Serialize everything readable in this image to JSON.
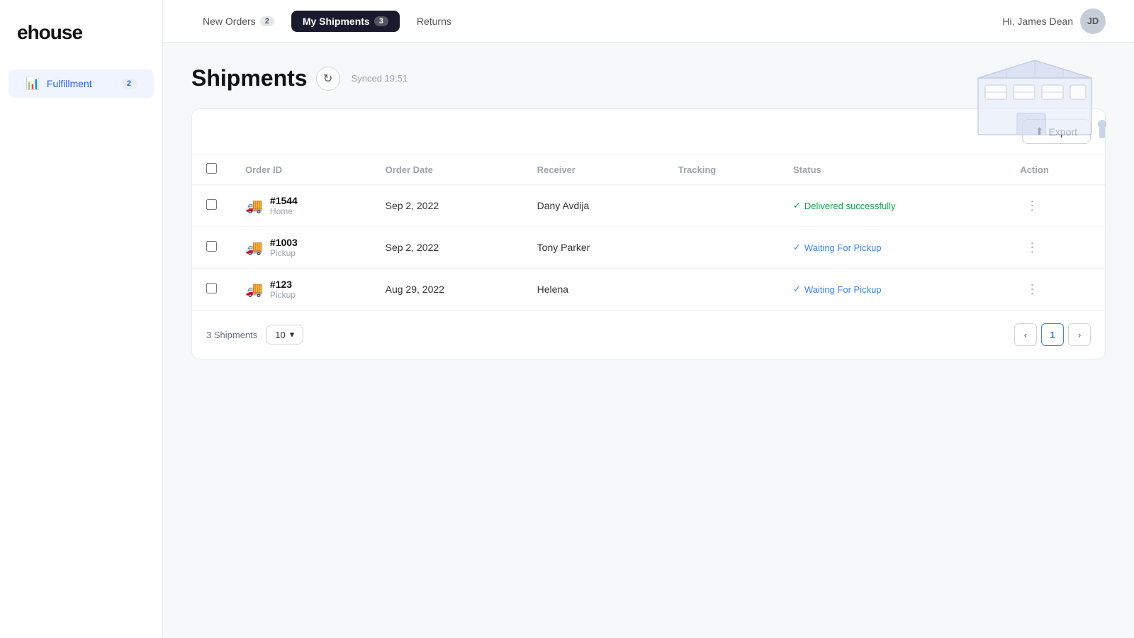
{
  "app": {
    "logo": "ehouse"
  },
  "sidebar": {
    "items": [
      {
        "id": "fulfillment",
        "label": "Fulfillment",
        "icon": "📊",
        "badge": "2",
        "active": true
      }
    ]
  },
  "topnav": {
    "items": [
      {
        "id": "new-orders",
        "label": "New Orders",
        "badge": "2",
        "active": false
      },
      {
        "id": "my-shipments",
        "label": "My Shipments",
        "badge": "3",
        "active": true
      },
      {
        "id": "returns",
        "label": "Returns",
        "badge": null,
        "active": false
      }
    ],
    "greeting": "Hi, James Dean",
    "avatar_initials": "JD"
  },
  "page": {
    "title": "Shipments",
    "sync_label": "Synced 19:51",
    "export_label": "Export"
  },
  "table": {
    "columns": [
      "Order ID",
      "Order Date",
      "Receiver",
      "Tracking",
      "Status",
      "Action"
    ],
    "rows": [
      {
        "order_id": "#1544",
        "order_type": "Home",
        "order_date": "Sep 2, 2022",
        "receiver": "Dany Avdija",
        "tracking": "",
        "status": "Delivered successfully",
        "status_type": "delivered"
      },
      {
        "order_id": "#1003",
        "order_type": "Pickup",
        "order_date": "Sep 2, 2022",
        "receiver": "Tony Parker",
        "tracking": "",
        "status": "Waiting For Pickup",
        "status_type": "pickup"
      },
      {
        "order_id": "#123",
        "order_type": "Pickup",
        "order_date": "Aug 29, 2022",
        "receiver": "Helena",
        "tracking": "",
        "status": "Waiting For Pickup",
        "status_type": "pickup"
      }
    ]
  },
  "pagination": {
    "total_label": "3 Shipments",
    "per_page": "10",
    "current_page": "1"
  }
}
